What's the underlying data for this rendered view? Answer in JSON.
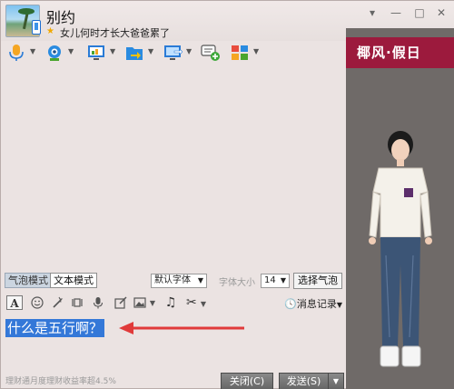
{
  "header": {
    "contact_name": "别约",
    "status_message": "女儿何时才长大爸爸累了",
    "window_controls": {
      "menu": "▾",
      "minimize": "—",
      "maximize": "□",
      "close": "✕"
    }
  },
  "toolbar": {
    "items": [
      {
        "icon": "microphone-icon"
      },
      {
        "icon": "video-camera-icon"
      },
      {
        "icon": "screen-share-icon"
      },
      {
        "icon": "file-transfer-icon"
      },
      {
        "icon": "remote-desktop-icon"
      },
      {
        "icon": "group-chat-add-icon"
      },
      {
        "icon": "apps-grid-icon"
      }
    ]
  },
  "side_panel": {
    "banner_text": "椰风·假日"
  },
  "mode_bar": {
    "bubble_mode": "气泡模式",
    "text_mode": "文本模式",
    "font_select_value": "默认字体",
    "font_size_label": "字体大小",
    "font_size_value": "14",
    "select_bubble_button": "选择气泡"
  },
  "format_bar": {
    "font_button": "A",
    "history_button": "消息记录"
  },
  "input": {
    "typed_text": "什么是五行啊？"
  },
  "footer": {
    "ad_text": "理财通月度理财收益率超4.5%",
    "close_button": "关闭(C)",
    "send_button": "发送(S)",
    "send_dropdown": "▼"
  },
  "colors": {
    "banner": "#9c1a3d",
    "selection": "#3478d8",
    "arrow": "#e03a3a"
  }
}
